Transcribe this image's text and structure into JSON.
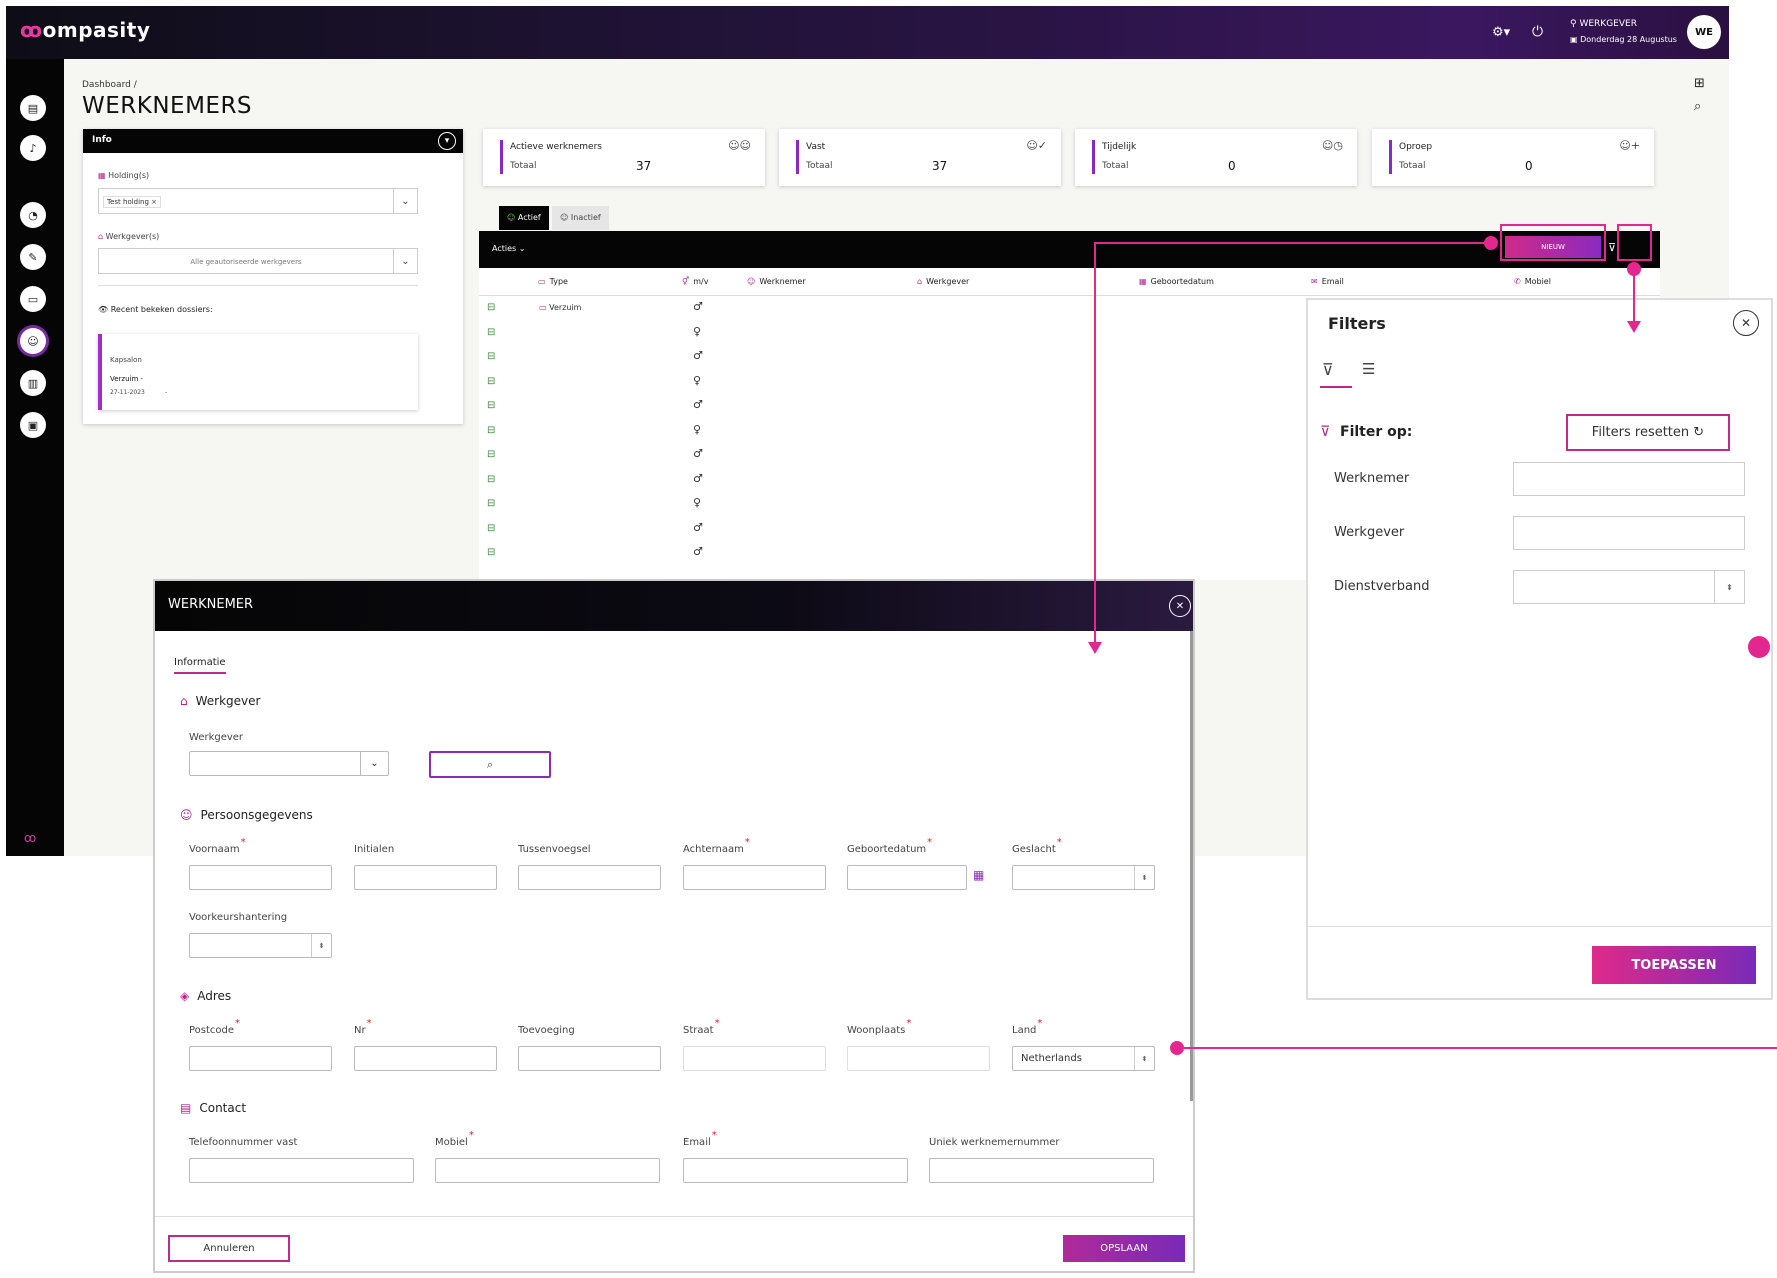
{
  "app": {
    "logo": "ompasity",
    "user_role": "WERKGEVER",
    "date": "Donderdag 28 Augustus",
    "avatar": "WE",
    "accent_color": "#e4278f",
    "brand_purple": "#8a2bbf"
  },
  "header": {
    "breadcrumb": "Dashboard  /",
    "title": "WERKNEMERS"
  },
  "info": {
    "title": "Info",
    "holding_label": "Holding(s)",
    "holding_chip": "Test holding ×",
    "werkgever_label": "Werkgever(s)",
    "werkgever_placeholder": "Alle geautoriseerde werkgevers",
    "recent_label": "Recent bekeken dossiers:",
    "dossier_name": "Kapsalon",
    "dossier_type": "Verzuim -",
    "dossier_date": "27-11-2023",
    "dossier_dash": "-"
  },
  "stats": [
    {
      "title": "Actieve werknemers",
      "sub": "Totaal",
      "value": "37",
      "icon": "users-icon"
    },
    {
      "title": "Vast",
      "sub": "Totaal",
      "value": "37",
      "icon": "user-check-icon"
    },
    {
      "title": "Tijdelijk",
      "sub": "Totaal",
      "value": "0",
      "icon": "user-clock-icon"
    },
    {
      "title": "Oproep",
      "sub": "Totaal",
      "value": "0",
      "icon": "user-plus-icon"
    }
  ],
  "tabs": {
    "active": "Actief",
    "inactive": "Inactief"
  },
  "table": {
    "acties": "Acties",
    "new_button": "NIEUW",
    "columns": [
      "Type",
      "m/v",
      "Werknemer",
      "Werkgever",
      "Geboortedatum",
      "Email",
      "Mobiel"
    ],
    "first_type": "Verzuim",
    "genders": [
      "♂",
      "♀",
      "♂",
      "♀",
      "♂",
      "♀",
      "♂",
      "♂",
      "♀",
      "♂",
      "♂"
    ]
  },
  "filters": {
    "title": "Filters",
    "filter_op": "Filter op:",
    "reset": "Filters resetten",
    "fields": [
      "Werknemer",
      "Werkgever",
      "Dienstverband"
    ],
    "apply": "TOEPASSEN"
  },
  "modal": {
    "title": "WERKNEMER",
    "tab": "Informatie",
    "section_werkgever": "Werkgever",
    "werkgever_label": "Werkgever",
    "section_persoon": "Persoonsgegevens",
    "persoon_fields": [
      "Voornaam",
      "Initialen",
      "Tussenvoegsel",
      "Achternaam",
      "Geboortedatum",
      "Geslacht"
    ],
    "voorkeur_label": "Voorkeurshantering",
    "section_adres": "Adres",
    "adres_fields": [
      "Postcode",
      "Nr",
      "Toevoeging",
      "Straat",
      "Woonplaats",
      "Land"
    ],
    "land_value": "Netherlands",
    "section_contact": "Contact",
    "contact_fields": [
      "Telefoonnummer vast",
      "Mobiel",
      "Email",
      "Uniek werknemernummer"
    ],
    "cancel": "Annuleren",
    "save": "OPSLAAN"
  }
}
